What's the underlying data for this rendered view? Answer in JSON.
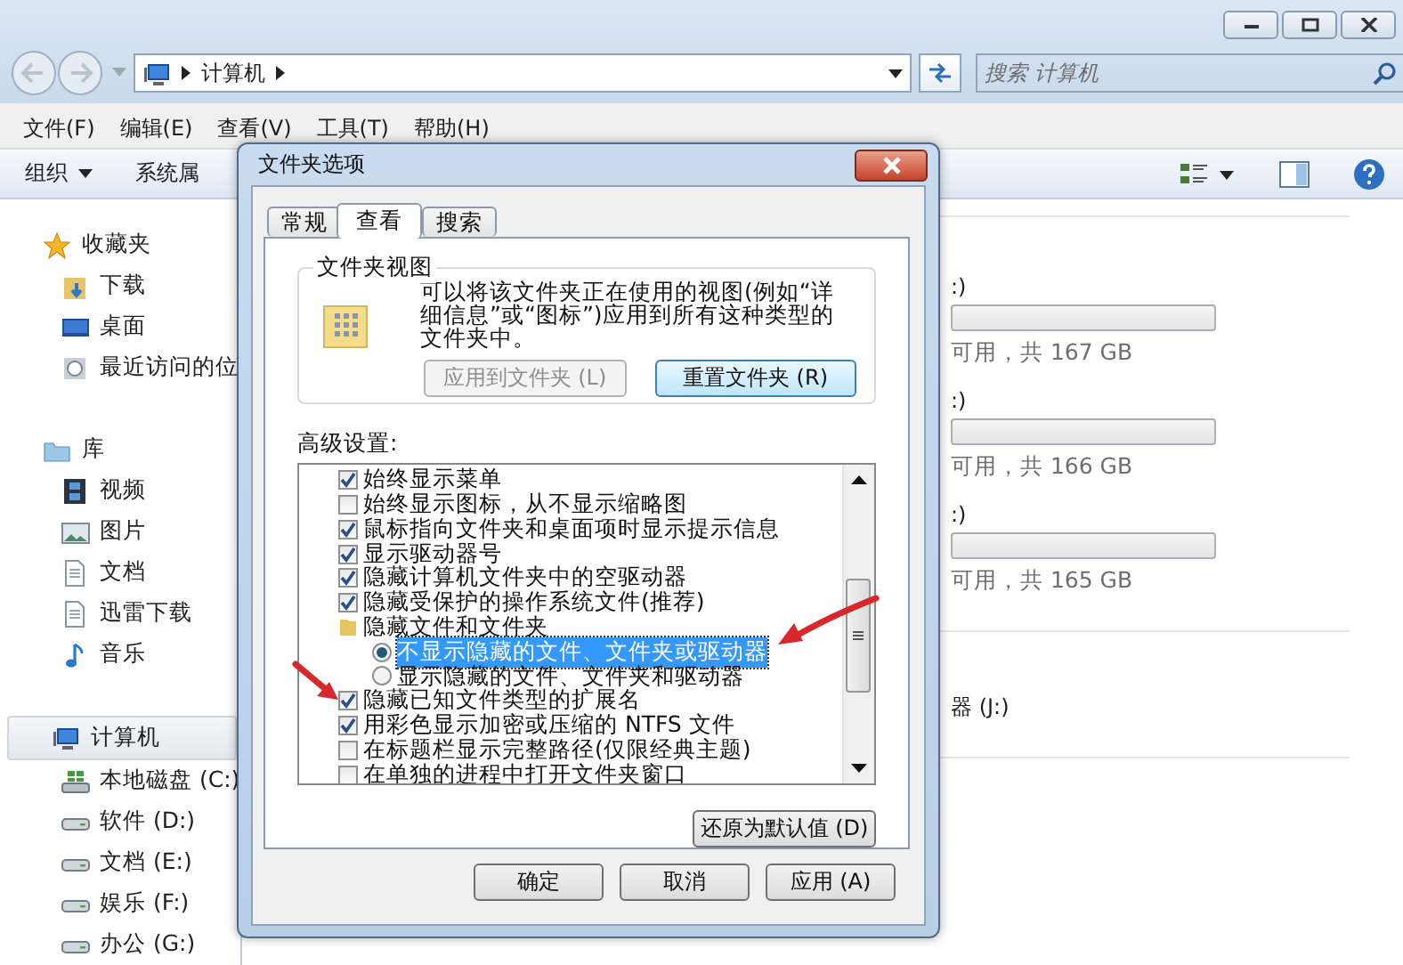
{
  "address_bar": {
    "path": [
      "计算机"
    ]
  },
  "search": {
    "placeholder": "搜索 计算机"
  },
  "menu_bar": [
    "文件(F)",
    "编辑(E)",
    "查看(V)",
    "工具(T)",
    "帮助(H)"
  ],
  "toolbar": [
    {
      "label": "组织",
      "kind": "dropdown"
    },
    {
      "label": "系统属",
      "kind": "plain"
    }
  ],
  "sidebar": {
    "sections": [
      {
        "label": "收藏夹",
        "selected": false,
        "children": [
          {
            "label": "下载"
          },
          {
            "label": "桌面"
          },
          {
            "label": "最近访问的位"
          }
        ]
      },
      {
        "label": "库",
        "selected": false,
        "children": [
          {
            "label": "视频"
          },
          {
            "label": "图片"
          },
          {
            "label": "文档"
          },
          {
            "label": "迅雷下载"
          },
          {
            "label": "音乐"
          }
        ]
      },
      {
        "label": "计算机",
        "selected": true,
        "children": [
          {
            "label": "本地磁盘 (C:)"
          },
          {
            "label": "软件 (D:)"
          },
          {
            "label": "文档 (E:)"
          },
          {
            "label": "娱乐 (F:)"
          },
          {
            "label": "办公 (G:)"
          }
        ]
      }
    ]
  },
  "drives": [
    {
      "name": ":)",
      "free": "可用，共 167 GB"
    },
    {
      "name": ":)",
      "free": "可用，共 166 GB"
    },
    {
      "name": ":)",
      "free": "可用，共 165 GB"
    }
  ],
  "removable": [
    {
      "name": "器 (J:)"
    }
  ],
  "dialog": {
    "title": "文件夹选项",
    "tabs": [
      {
        "label": "常规",
        "selected": false
      },
      {
        "label": "查看",
        "selected": true
      },
      {
        "label": "搜索",
        "selected": false
      }
    ],
    "folder_views": {
      "title": "文件夹视图",
      "description": "可以将该文件夹正在使用的视图(例如“详细信息”或“图标”)应用到所有这种类型的文件夹中。",
      "buttons": [
        {
          "label": "应用到文件夹 (L)",
          "disabled": true
        },
        {
          "label": "重置文件夹 (R)",
          "disabled": false
        }
      ]
    },
    "advanced": {
      "label": "高级设置:",
      "items": [
        {
          "kind": "checkbox",
          "label": "始终显示菜单",
          "checked": true
        },
        {
          "kind": "checkbox",
          "label": "始终显示图标，从不显示缩略图",
          "checked": false
        },
        {
          "kind": "checkbox",
          "label": "鼠标指向文件夹和桌面项时显示提示信息",
          "checked": true
        },
        {
          "kind": "checkbox",
          "label": "显示驱动器号",
          "checked": true
        },
        {
          "kind": "checkbox",
          "label": "隐藏计算机文件夹中的空驱动器",
          "checked": true
        },
        {
          "kind": "checkbox",
          "label": "隐藏受保护的操作系统文件(推荐)",
          "checked": true
        },
        {
          "kind": "folder",
          "label": "隐藏文件和文件夹",
          "children": [
            {
              "kind": "radio",
              "label": "不显示隐藏的文件、文件夹或驱动器",
              "selected": true
            },
            {
              "kind": "radio",
              "label": "显示隐藏的文件、文件夹和驱动器",
              "selected": false
            }
          ]
        },
        {
          "kind": "checkbox",
          "label": "隐藏已知文件类型的扩展名",
          "checked": true
        },
        {
          "kind": "checkbox",
          "label": "用彩色显示加密或压缩的 NTFS 文件",
          "checked": true
        },
        {
          "kind": "checkbox",
          "label": "在标题栏显示完整路径(仅限经典主题)",
          "checked": false
        },
        {
          "kind": "checkbox",
          "label": "在单独的进程中打开文件夹窗口",
          "checked": false
        }
      ]
    },
    "restore_button": "还原为默认值 (D)",
    "buttons": [
      "确定",
      "取消",
      "应用 (A)"
    ]
  }
}
